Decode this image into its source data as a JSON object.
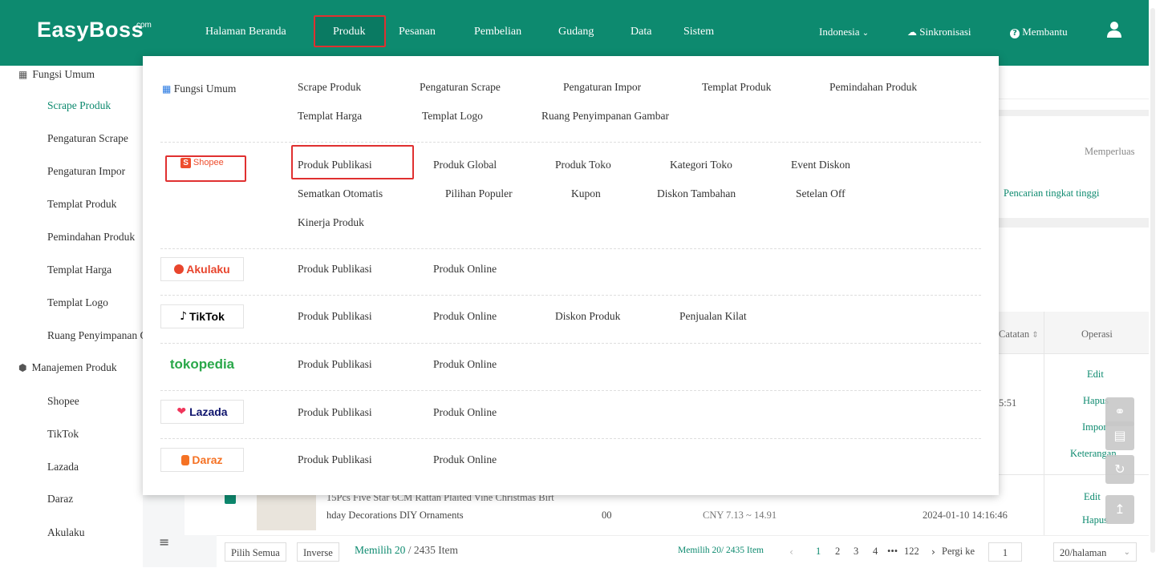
{
  "app": {
    "logo": "EasyBoss",
    "logo_suffix": "com"
  },
  "topnav": {
    "items": [
      "Halaman Beranda",
      "Produk",
      "Pesanan",
      "Pembelian",
      "Gudang",
      "Data",
      "Sistem"
    ],
    "active": "Produk",
    "region": "Indonesia",
    "sync": "Sinkronisasi",
    "help": "Membantu"
  },
  "sidebar": {
    "group1": "Fungsi Umum",
    "group1_items": [
      "Scrape Produk",
      "Pengaturan Scrape",
      "Pengaturan Impor",
      "Templat Produk",
      "Pemindahan Produk",
      "Templat Harga",
      "Templat Logo",
      "Ruang Penyimpanan Gambar"
    ],
    "active_item": "Scrape Produk",
    "group2": "Manajemen Produk",
    "group2_items": [
      "Shopee",
      "TikTok",
      "Lazada",
      "Daraz",
      "Akulaku"
    ]
  },
  "dropdown": {
    "general_label": "Fungsi Umum",
    "general_row1": [
      "Scrape Produk",
      "Pengaturan Scrape",
      "Pengaturan Impor",
      "Templat Produk",
      "Pemindahan Produk"
    ],
    "general_row2": [
      "Templat Harga",
      "Templat Logo",
      "Ruang Penyimpanan Gambar"
    ],
    "shopee": {
      "logo": "Shopee",
      "row1": [
        "Produk Publikasi",
        "Produk Global",
        "Produk Toko",
        "Kategori Toko",
        "Event Diskon"
      ],
      "row2": [
        "Sematkan Otomatis",
        "Pilihan Populer",
        "Kupon",
        "Diskon Tambahan",
        "Setelan Off"
      ],
      "row3": [
        "Kinerja Produk"
      ]
    },
    "akulaku": {
      "logo": "Akulaku",
      "links": [
        "Produk Publikasi",
        "Produk Online"
      ]
    },
    "tiktok": {
      "logo": "TikTok",
      "links": [
        "Produk Publikasi",
        "Produk Online",
        "Diskon Produk",
        "Penjualan Kilat"
      ]
    },
    "tokopedia": {
      "logo": "tokopedia",
      "links": [
        "Produk Publikasi",
        "Produk Online"
      ]
    },
    "lazada": {
      "logo": "Lazada",
      "links": [
        "Produk Publikasi",
        "Produk Online"
      ]
    },
    "daraz": {
      "logo": "Daraz",
      "links": [
        "Produk Publikasi",
        "Produk Online"
      ]
    }
  },
  "background": {
    "expand": "Memperluas",
    "advanced_search": "Pencarian tingkat tinggi",
    "col_note": "Catatan",
    "col_ops": "Operasi",
    "row1_time_fragment": "5:51",
    "row1_actions": [
      "Edit",
      "Hapus",
      "Impor",
      "Keterangan"
    ],
    "row2_title_line1": "15Pcs Five Star 6CM Rattan Plaited Vine Christmas Birt",
    "row2_title_line2": "hday Decorations DIY Ornaments",
    "row2_price_fragment": "00",
    "row2_cny": "CNY 7.13 ~ 14.91",
    "row2_time": "2024-01-10 14:16:46",
    "row2_actions": [
      "Edit",
      "Hapus"
    ]
  },
  "bottombar": {
    "select_all": "Pilih Semua",
    "inverse": "Inverse",
    "selected_a": "Memilih 20",
    "selected_b": " / 2435 Item",
    "selected_small": "Memilih 20/ 2435 Item",
    "pages": [
      "1",
      "2",
      "3",
      "4",
      "•••",
      "122"
    ],
    "goto": "Pergi ke",
    "goto_value": "1",
    "page_size": "20/halaman"
  }
}
